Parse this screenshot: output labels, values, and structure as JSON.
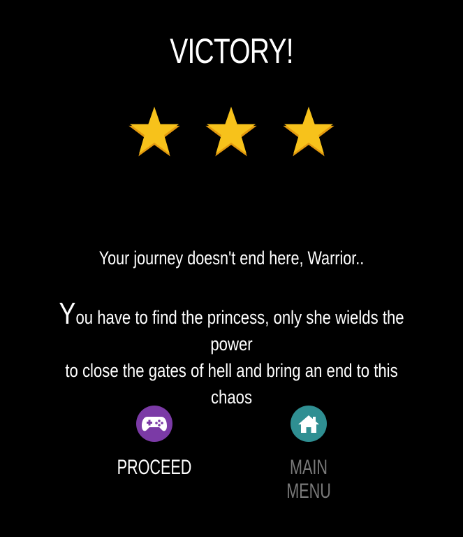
{
  "screen": {
    "title": "VICTORY!",
    "stars": {
      "earned": 3,
      "total": 3,
      "color": "#F7C21B",
      "edge_color": "#E39A0F"
    },
    "subtitle": "Your journey doesn't end here, Warrior..",
    "story": {
      "first_letter": "Y",
      "line1_rest": "ou have to find the princess, only she wields the power",
      "line2": "to close the gates of hell and bring an end to this chaos"
    }
  },
  "actions": {
    "proceed": {
      "label": "PROCEED",
      "icon": "gamepad-icon",
      "circle_color": "#7B3AA6",
      "label_color": "#FFFFFF"
    },
    "main_menu": {
      "label": "MAIN MENU",
      "icon": "home-icon",
      "circle_color": "#2F8F92",
      "label_color": "#7A7A7A"
    }
  }
}
